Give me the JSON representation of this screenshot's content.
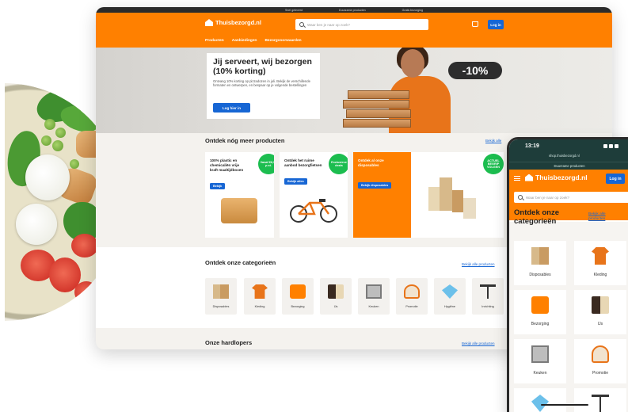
{
  "topbar": {
    "items": [
      "Snel geleverd",
      "Duurzame producten",
      "Gratis bezorging"
    ]
  },
  "brand": {
    "name": "Thuisbezorgd.nl",
    "orange": "#ff8000",
    "blue": "#1766d4",
    "green": "#1cbd4f"
  },
  "desktop": {
    "search_placeholder": "Waar ben je naar op zoek?",
    "login_label": "Log in",
    "nav": [
      "Producten",
      "Aanbiedingen",
      "Bezorgvoorwaarden"
    ],
    "hero": {
      "title": "Jij serveert, wij bezorgen (10% korting)",
      "text": "Ontvang 10% korting op pizzadozen in juli. Bekijk de verschillende formaten en ontwerpen, en bespaar op je volgende bestellingen",
      "button": "Log hier in",
      "discount": "-10%"
    },
    "more_products": {
      "title": "Ontdek nóg meer producten",
      "link": "Bekijk alle",
      "cards": [
        {
          "text": "100% plastic en chemicaliën vrije kraft maaltijdboxen",
          "button": "Bekijk",
          "badge": "Vanaf €6,95 p.st."
        },
        {
          "text": "Ontdek het ruime aanbod bezorgfietsen",
          "button": "Bekijk alles",
          "badge": "Exclusieve deals"
        },
        {
          "text": "Ontdek al onze disposables",
          "button": "Bekijk disposables",
          "badge": ""
        },
        {
          "text": "",
          "button": "",
          "badge": "ACTUEL BEGRIP VOLGEN"
        }
      ]
    },
    "categories": {
      "title": "Ontdek onze categorieën",
      "link": "Bekijk alle producten",
      "items": [
        "Disposables",
        "Kleding",
        "Bezorging",
        "IJs",
        "Keuken",
        "Promotie",
        "Hygiëne",
        "Inrichting"
      ]
    },
    "bestsellers": {
      "title": "Onze hardlopers",
      "link": "Bekijk alle producten"
    }
  },
  "phone": {
    "time": "13:19",
    "url": "shop.thuisbezorgd.nl",
    "banner": "Duurzame producten",
    "login_label": "Log in",
    "search_placeholder": "Waar ben je naar op zoek?",
    "categories_title": "Ontdek onze categorieën",
    "categories_link": "Bekijk alle producten",
    "categories": [
      "Disposables",
      "Kleding",
      "Bezorging",
      "IJs",
      "Keuken",
      "Promotie"
    ]
  }
}
